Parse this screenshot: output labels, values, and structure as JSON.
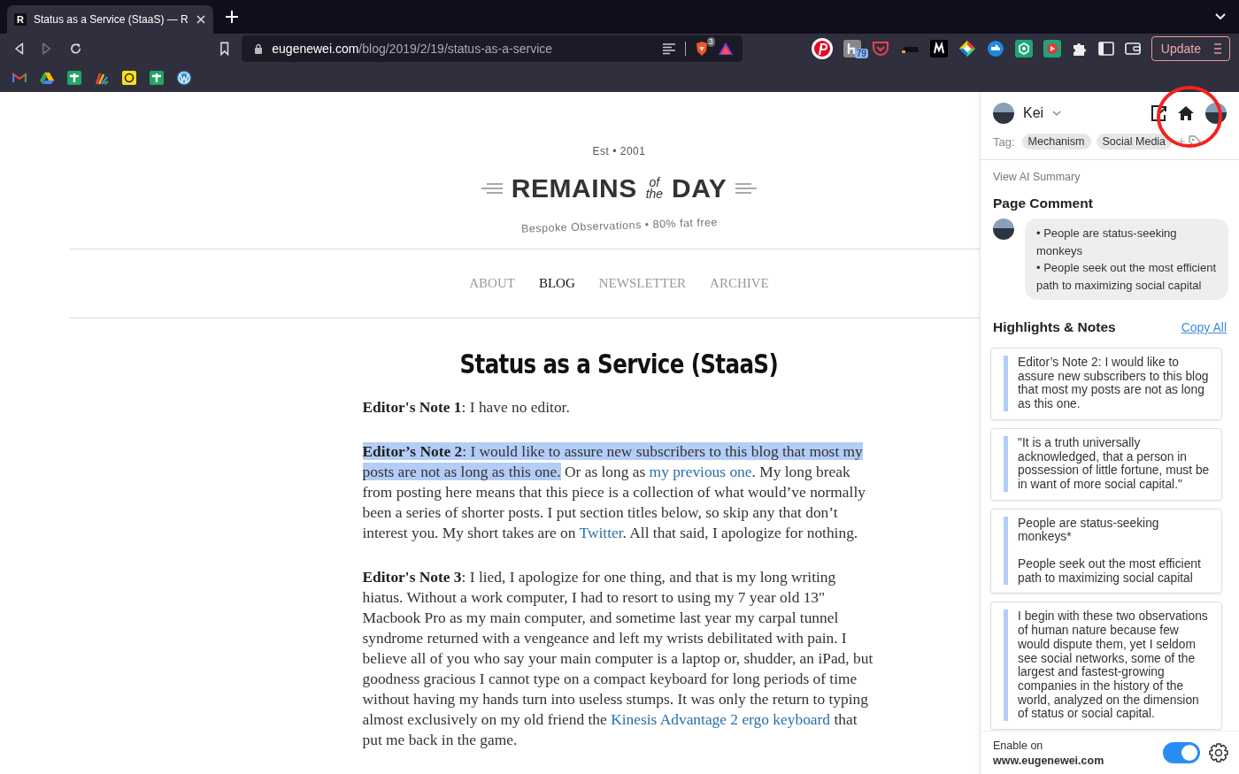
{
  "browser": {
    "tab": {
      "favicon": "R",
      "title": "Status as a Service (StaaS) — R",
      "selected": true
    },
    "address": {
      "domain": "eugenewei.com",
      "path": "/blog/2019/2/19/status-as-a-service"
    },
    "shield_badge": "3",
    "extension_badge": "79",
    "update_button": "Update"
  },
  "site": {
    "established": "Est • 2001",
    "logo": {
      "left": "REMAINS",
      "of": "of",
      "the": "the",
      "right": "DAY"
    },
    "tagline": "Bespoke Observations • 80% fat free",
    "nav": [
      {
        "label": "ABOUT",
        "selected": false
      },
      {
        "label": "BLOG",
        "selected": true
      },
      {
        "label": "NEWSLETTER",
        "selected": false
      },
      {
        "label": "ARCHIVE",
        "selected": false
      }
    ]
  },
  "article": {
    "title": "Status as a Service (StaaS)",
    "paragraphs": [
      [
        {
          "text": "Editor's Note 1",
          "kind": "bold",
          "highlighted": false
        },
        {
          "text": ": I have no editor.",
          "kind": "text",
          "highlighted": false
        }
      ],
      [
        {
          "text": "Editor’s Note 2",
          "kind": "bold",
          "highlighted": true
        },
        {
          "text": ": I would like to assure new subscribers to this blog that most my posts are not as long as this one.",
          "kind": "text",
          "highlighted": true
        },
        {
          "text": " Or as long as ",
          "kind": "text",
          "highlighted": false
        },
        {
          "text": "my previous one",
          "kind": "link",
          "highlighted": false
        },
        {
          "text": ". My long break from posting here means that this piece is a collection of what would’ve normally been a series of shorter posts. I put section titles below, so skip any that don’t interest you. My short takes are on ",
          "kind": "text",
          "highlighted": false
        },
        {
          "text": "Twitter",
          "kind": "link",
          "highlighted": false
        },
        {
          "text": ". All that said, I apologize for nothing.",
          "kind": "text",
          "highlighted": false
        }
      ],
      [
        {
          "text": "Editor's Note 3",
          "kind": "bold",
          "highlighted": false
        },
        {
          "text": ": I lied, I apologize for one thing, and that is my long writing hiatus. Without a work computer, I had to resort to using my 7 year old 13\" Macbook Pro as my main computer, and sometime last year my carpal tunnel syndrome returned with a vengeance and left my wrists debilitated with pain. I believe all of you who say your main computer is a laptop or, shudder, an iPad, but goodness gracious I cannot type on a compact keyboard for long periods of time without having my hands turn into useless stumps. It was only the return to typing almost exclusively on my old friend the ",
          "kind": "text",
          "highlighted": false
        },
        {
          "text": "Kinesis Advantage 2 ergo keyboard",
          "kind": "link",
          "highlighted": false
        },
        {
          "text": " that put me back in the game.",
          "kind": "text",
          "highlighted": false
        }
      ]
    ]
  },
  "sidebar": {
    "user": {
      "name": "Kei"
    },
    "tags_label": "Tag:",
    "tags": [
      "Mechanism",
      "Social Media"
    ],
    "ai_summary": "View AI Summary",
    "page_comment": {
      "heading": "Page Comment",
      "lines": [
        "• People are status-seeking monkeys",
        "• People seek out the most efficient path to maximizing social capital"
      ]
    },
    "highlights": {
      "heading": "Highlights & Notes",
      "copy_all": "Copy All",
      "items": [
        {
          "paragraphs": [
            "Editor’s Note 2: I would like to assure new subscribers to this blog that most my posts are not as long as this one."
          ]
        },
        {
          "paragraphs": [
            "\"It is a truth universally acknowledged, that a person in possession of little fortune, must be in want of more social capital.\""
          ]
        },
        {
          "paragraphs": [
            "People are status-seeking monkeys*",
            "People seek out the most efficient path to maximizing social capital"
          ]
        },
        {
          "paragraphs": [
            "I begin with these two observations of human nature because few would dispute them, yet I seldom see social networks, some of the largest and fastest-growing companies in the history of the world, analyzed on the dimension of status or social capital."
          ]
        }
      ]
    },
    "footer": {
      "label": "Enable on",
      "domain": "www.eugenewei.com",
      "enabled": true
    }
  }
}
